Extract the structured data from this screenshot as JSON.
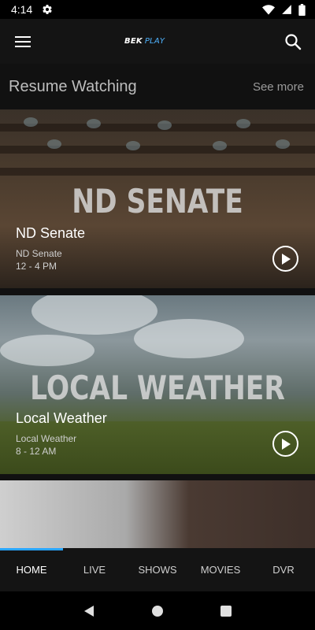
{
  "status_bar": {
    "time": "4:14",
    "icons": [
      "settings-icon",
      "wifi-icon",
      "signal-icon",
      "battery-icon"
    ]
  },
  "app_bar": {
    "logo_part1": "BEK",
    "logo_part2": "PLAY",
    "menu_icon": "hamburger-menu-icon",
    "search_icon": "search-icon",
    "accent_color": "#2aa6ff"
  },
  "resume_section": {
    "title": "Resume Watching",
    "see_more": "See more"
  },
  "cards": [
    {
      "image_text": "ND SENATE",
      "title": "ND Senate",
      "channel": "ND Senate",
      "time": "12 - 4 PM"
    },
    {
      "image_text": "LOCAL WEATHER",
      "title": "Local Weather",
      "channel": "Local Weather",
      "time": "8 - 12 AM"
    }
  ],
  "tabs": [
    {
      "label": "HOME",
      "active": true
    },
    {
      "label": "LIVE",
      "active": false
    },
    {
      "label": "SHOWS",
      "active": false
    },
    {
      "label": "MOVIES",
      "active": false
    },
    {
      "label": "DVR",
      "active": false
    }
  ],
  "nav_bar": {
    "icons": [
      "back-icon",
      "home-icon",
      "recents-icon"
    ]
  }
}
